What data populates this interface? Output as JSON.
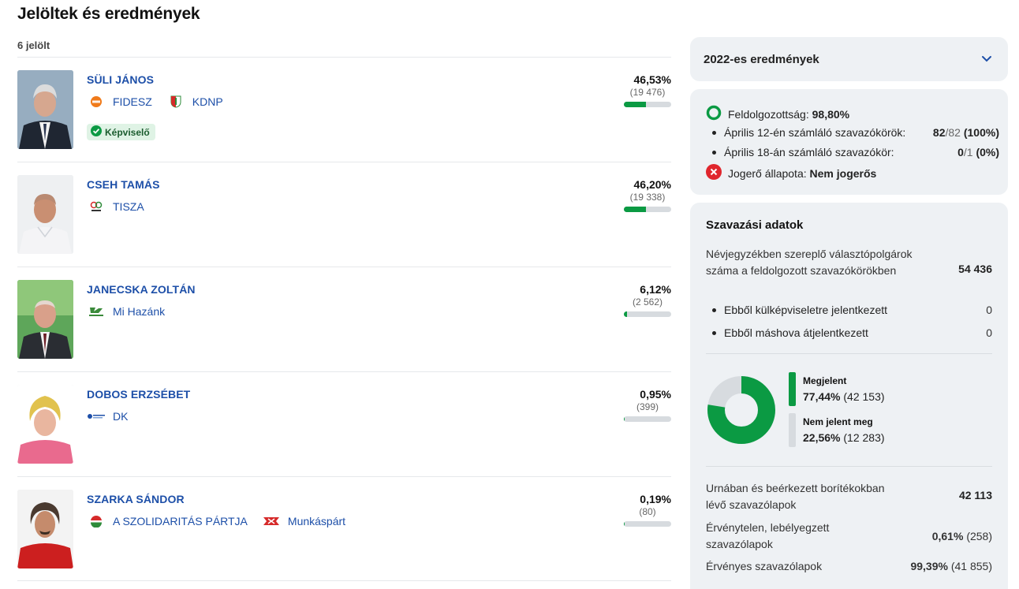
{
  "page": {
    "title": "Jelöltek és eredmények",
    "count": "6 jelölt"
  },
  "candidates": [
    {
      "name": "SÜLI JÁNOS",
      "parties": [
        "FIDESZ",
        "KDNP"
      ],
      "badge": "Képviselő",
      "pct": "46,53%",
      "votes": "(19 476)",
      "share": 46.53
    },
    {
      "name": "CSEH TAMÁS",
      "parties": [
        "TISZA"
      ],
      "pct": "46,20%",
      "votes": "(19 338)",
      "share": 46.2
    },
    {
      "name": "JANECSKA ZOLTÁN",
      "parties": [
        "Mi Hazánk"
      ],
      "pct": "6,12%",
      "votes": "(2 562)",
      "share": 6.12
    },
    {
      "name": "DOBOS ERZSÉBET",
      "parties": [
        "DK"
      ],
      "pct": "0,95%",
      "votes": "(399)",
      "share": 0.95
    },
    {
      "name": "SZARKA SÁNDOR",
      "parties": [
        "A SZOLIDARITÁS PÁRTJA",
        "Munkáspárt"
      ],
      "pct": "0,19%",
      "votes": "(80)",
      "share": 0.19
    }
  ],
  "results_dropdown": {
    "label": "2022-es eredmények"
  },
  "processing": {
    "processed_label": "Feldolgozottság:",
    "processed_value": "98,80%",
    "apr12_label": "Április 12-én számláló szavazókörök:",
    "apr12_num": "82",
    "apr12_den": "/82",
    "apr12_pct": "(100%)",
    "apr18_label": "Április 18-án számláló szavazókör:",
    "apr18_num": "0",
    "apr18_den": "/1",
    "apr18_pct": "(0%)",
    "legal_label": "Jogerő állapota:",
    "legal_value": "Nem jogerős"
  },
  "voting": {
    "title": "Szavazási adatok",
    "registered_label": "Névjegyzékben szereplő választópolgárok száma a feldolgozott szavazókörökben",
    "registered_value": "54 436",
    "abroad_label": "Ebből külképviseletre jelentkezett",
    "abroad_value": "0",
    "moved_label": "Ebből máshova átjelentkezett",
    "moved_value": "0",
    "turnout_label": "Megjelent",
    "turnout_pct": "77,44%",
    "turnout_count": "(42 153)",
    "turnout_share": 77.44,
    "absent_label": "Nem jelent meg",
    "absent_pct": "22,56%",
    "absent_count": "(12 283)",
    "ballots_label": "Urnában és beérkezett borítékokban lévő szavazólapok",
    "ballots_value": "42 113",
    "invalid_label": "Érvénytelen, lebélyegzett szavazólapok",
    "invalid_pct": "0,61%",
    "invalid_count": "(258)",
    "valid_label": "Érvényes szavazólapok",
    "valid_pct": "99,39%",
    "valid_count": "(41 855)"
  },
  "colors": {
    "accent": "#1d4fa8",
    "green": "#0b9a43",
    "grey": "#d7dbdf",
    "red": "#e0262d"
  }
}
